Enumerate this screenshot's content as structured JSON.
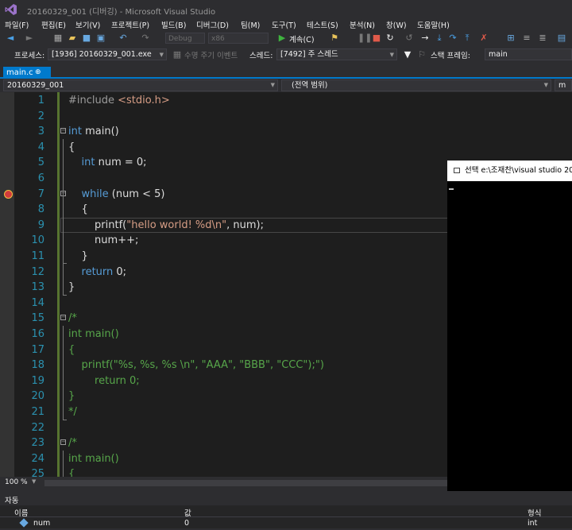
{
  "window": {
    "title": "20160329_001 (디버깅) - Microsoft Visual Studio"
  },
  "menu": [
    "파일(F)",
    "편집(E)",
    "보기(V)",
    "프로젝트(P)",
    "빌드(B)",
    "디버그(D)",
    "팀(M)",
    "도구(T)",
    "테스트(S)",
    "분석(N)",
    "창(W)",
    "도움말(H)"
  ],
  "toolbar": {
    "config": "Debug",
    "platform": "x86",
    "continue_label": "계속(C)"
  },
  "debug_location": {
    "process_label": "프로세스:",
    "process_value": "[1936] 20160329_001.exe",
    "lifecycle_label": "수명 주기 이벤트",
    "thread_label": "스레드:",
    "thread_value": "[7492] 주 스레드",
    "stack_label": "스택 프레임:",
    "stack_value": "main"
  },
  "tab": {
    "label": "main.c",
    "pin": "⊕"
  },
  "nav": {
    "project": "20160329_001",
    "scope": "(전역 범위)",
    "member": "m"
  },
  "editor": {
    "current_line": 9,
    "breakpoint_line": 7,
    "lines": [
      {
        "n": "1",
        "segs": [
          [
            "pp",
            "#include "
          ],
          [
            "str",
            "<stdio.h>"
          ]
        ]
      },
      {
        "n": "2",
        "segs": []
      },
      {
        "n": "3",
        "segs": [
          [
            "kw",
            "int"
          ],
          [
            "ctext",
            " main()"
          ]
        ]
      },
      {
        "n": "4",
        "segs": [
          [
            "ctext",
            "{"
          ]
        ]
      },
      {
        "n": "5",
        "segs": [
          [
            "ctext",
            "    "
          ],
          [
            "kw",
            "int"
          ],
          [
            "ctext",
            " num = 0;"
          ]
        ]
      },
      {
        "n": "6",
        "segs": []
      },
      {
        "n": "7",
        "segs": [
          [
            "ctext",
            "    "
          ],
          [
            "kw",
            "while"
          ],
          [
            "ctext",
            " (num < 5)"
          ]
        ]
      },
      {
        "n": "8",
        "segs": [
          [
            "ctext",
            "    {"
          ]
        ]
      },
      {
        "n": "9",
        "segs": [
          [
            "ctext",
            "        printf("
          ],
          [
            "str",
            "\"hello world! %d\\n\""
          ],
          [
            "ctext",
            ", num);"
          ]
        ]
      },
      {
        "n": "10",
        "segs": [
          [
            "ctext",
            "        num++;"
          ]
        ]
      },
      {
        "n": "11",
        "segs": [
          [
            "ctext",
            "    }"
          ]
        ]
      },
      {
        "n": "12",
        "segs": [
          [
            "ctext",
            "    "
          ],
          [
            "kw",
            "return"
          ],
          [
            "ctext",
            " 0;"
          ]
        ]
      },
      {
        "n": "13",
        "segs": [
          [
            "ctext",
            "}"
          ]
        ]
      },
      {
        "n": "14",
        "segs": []
      },
      {
        "n": "15",
        "segs": [
          [
            "cm",
            "/*"
          ]
        ]
      },
      {
        "n": "16",
        "segs": [
          [
            "cm",
            "int main()"
          ]
        ]
      },
      {
        "n": "17",
        "segs": [
          [
            "cm",
            "{"
          ]
        ]
      },
      {
        "n": "18",
        "segs": [
          [
            "cm",
            "    printf(\"%s, %s, %s \\n\", \"AAA\", \"BBB\", \"CCC\");\")"
          ]
        ]
      },
      {
        "n": "19",
        "segs": [
          [
            "cm",
            "        return 0;"
          ]
        ]
      },
      {
        "n": "20",
        "segs": [
          [
            "cm",
            "}"
          ]
        ]
      },
      {
        "n": "21",
        "segs": [
          [
            "cm",
            "*/"
          ]
        ]
      },
      {
        "n": "22",
        "segs": []
      },
      {
        "n": "23",
        "segs": [
          [
            "cm",
            "/*"
          ]
        ]
      },
      {
        "n": "24",
        "segs": [
          [
            "cm",
            "int main()"
          ]
        ]
      },
      {
        "n": "25",
        "segs": [
          [
            "cm",
            "{"
          ]
        ]
      }
    ]
  },
  "console": {
    "title": "선택 e:\\조재찬\\visual studio 20"
  },
  "status": {
    "zoom": "100 %"
  },
  "autos": {
    "title": "자동",
    "columns": [
      "이름",
      "값",
      "형식"
    ],
    "rows": [
      {
        "name": "num",
        "value": "0",
        "type": "int"
      }
    ]
  },
  "colors": {
    "accent": "#007acc",
    "keyword": "#569cd6",
    "string": "#d69d85",
    "comment": "#57a64a",
    "line_number": "#2b91af"
  }
}
